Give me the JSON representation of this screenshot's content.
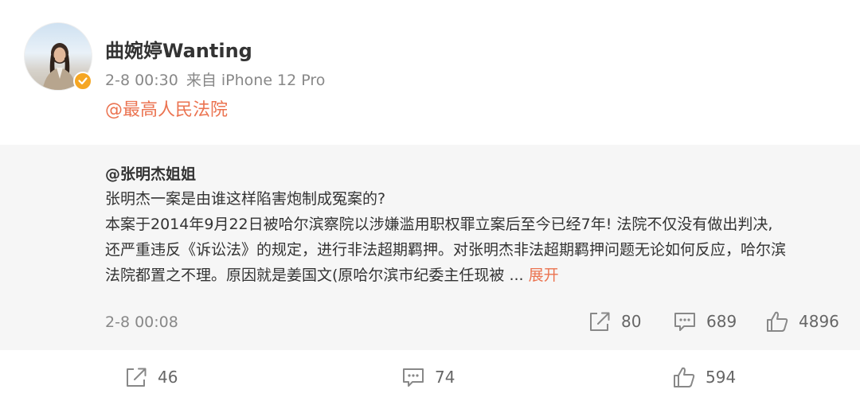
{
  "post": {
    "author_name": "曲婉婷Wanting",
    "time": "2-8 00:30",
    "source": "来自 iPhone 12 Pro",
    "text": "@最高人民法院",
    "avatar_icon": "avatar-photo",
    "verified_icon": "verified-badge-icon"
  },
  "repost": {
    "author": "@张明杰姐姐",
    "lines": [
      "张明杰一案是由谁这样陷害炮制成冤案的?",
      "本案于2014年9月22日被哈尔滨察院以涉嫌滥用职权罪立案后至今已经7年! 法院不仅没有做出判决,",
      "还严重违反《诉讼法》的规定，进行非法超期羁押。对张明杰非法超期羁押问题无论如何反应，哈尔滨",
      "法院都置之不理。原因就是姜国文(原哈尔滨市纪委主任现被  ... "
    ],
    "expand_label": "展开",
    "time": "2-8 00:08",
    "share_count": "80",
    "comment_count": "689",
    "like_count": "4896"
  },
  "actions": {
    "share_count": "46",
    "comment_count": "74",
    "like_count": "594"
  },
  "colors": {
    "link": "#eb7350",
    "muted": "#888888",
    "repost_bg": "#f6f6f6",
    "verified": "#f5a623"
  }
}
